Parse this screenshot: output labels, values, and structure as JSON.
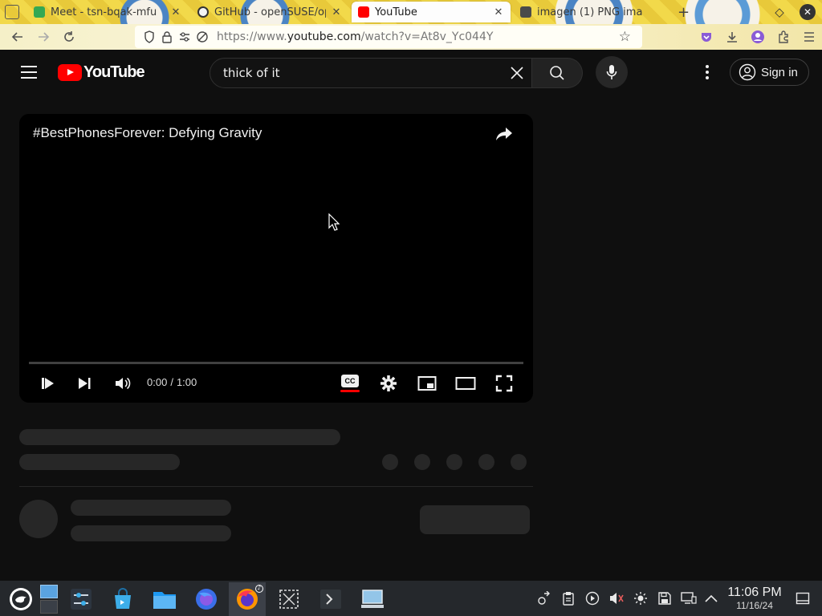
{
  "browser": {
    "tabs": [
      {
        "label": "Meet - tsn-bqak-mfu",
        "favicon_color": "#34a853"
      },
      {
        "label": "GitHub - openSUSE/op",
        "favicon_color": "#333333"
      },
      {
        "label": "YouTube",
        "favicon_color": "#ff0000"
      },
      {
        "label": "imagen (1) PNG ima",
        "favicon_color": "#4a4a4a"
      }
    ],
    "url_prefix": "https://www.",
    "url_host": "youtube.com",
    "url_path": "/watch?v=At8v_Yc044Y"
  },
  "header": {
    "logo_text": "YouTube",
    "search_value": "thick of it",
    "signin_label": "Sign in"
  },
  "player": {
    "title": "#BestPhonesForever: Defying Gravity",
    "time_current": "0:00",
    "time_separator": "/",
    "time_total": "1:00",
    "progress_fraction": 0,
    "cc_label": "CC"
  },
  "taskbar": {
    "time": "11:06 PM",
    "date": "11/16/24"
  },
  "colors": {
    "accent": "#ff0000",
    "background": "#0f0f0f",
    "placeholder": "#272727"
  }
}
